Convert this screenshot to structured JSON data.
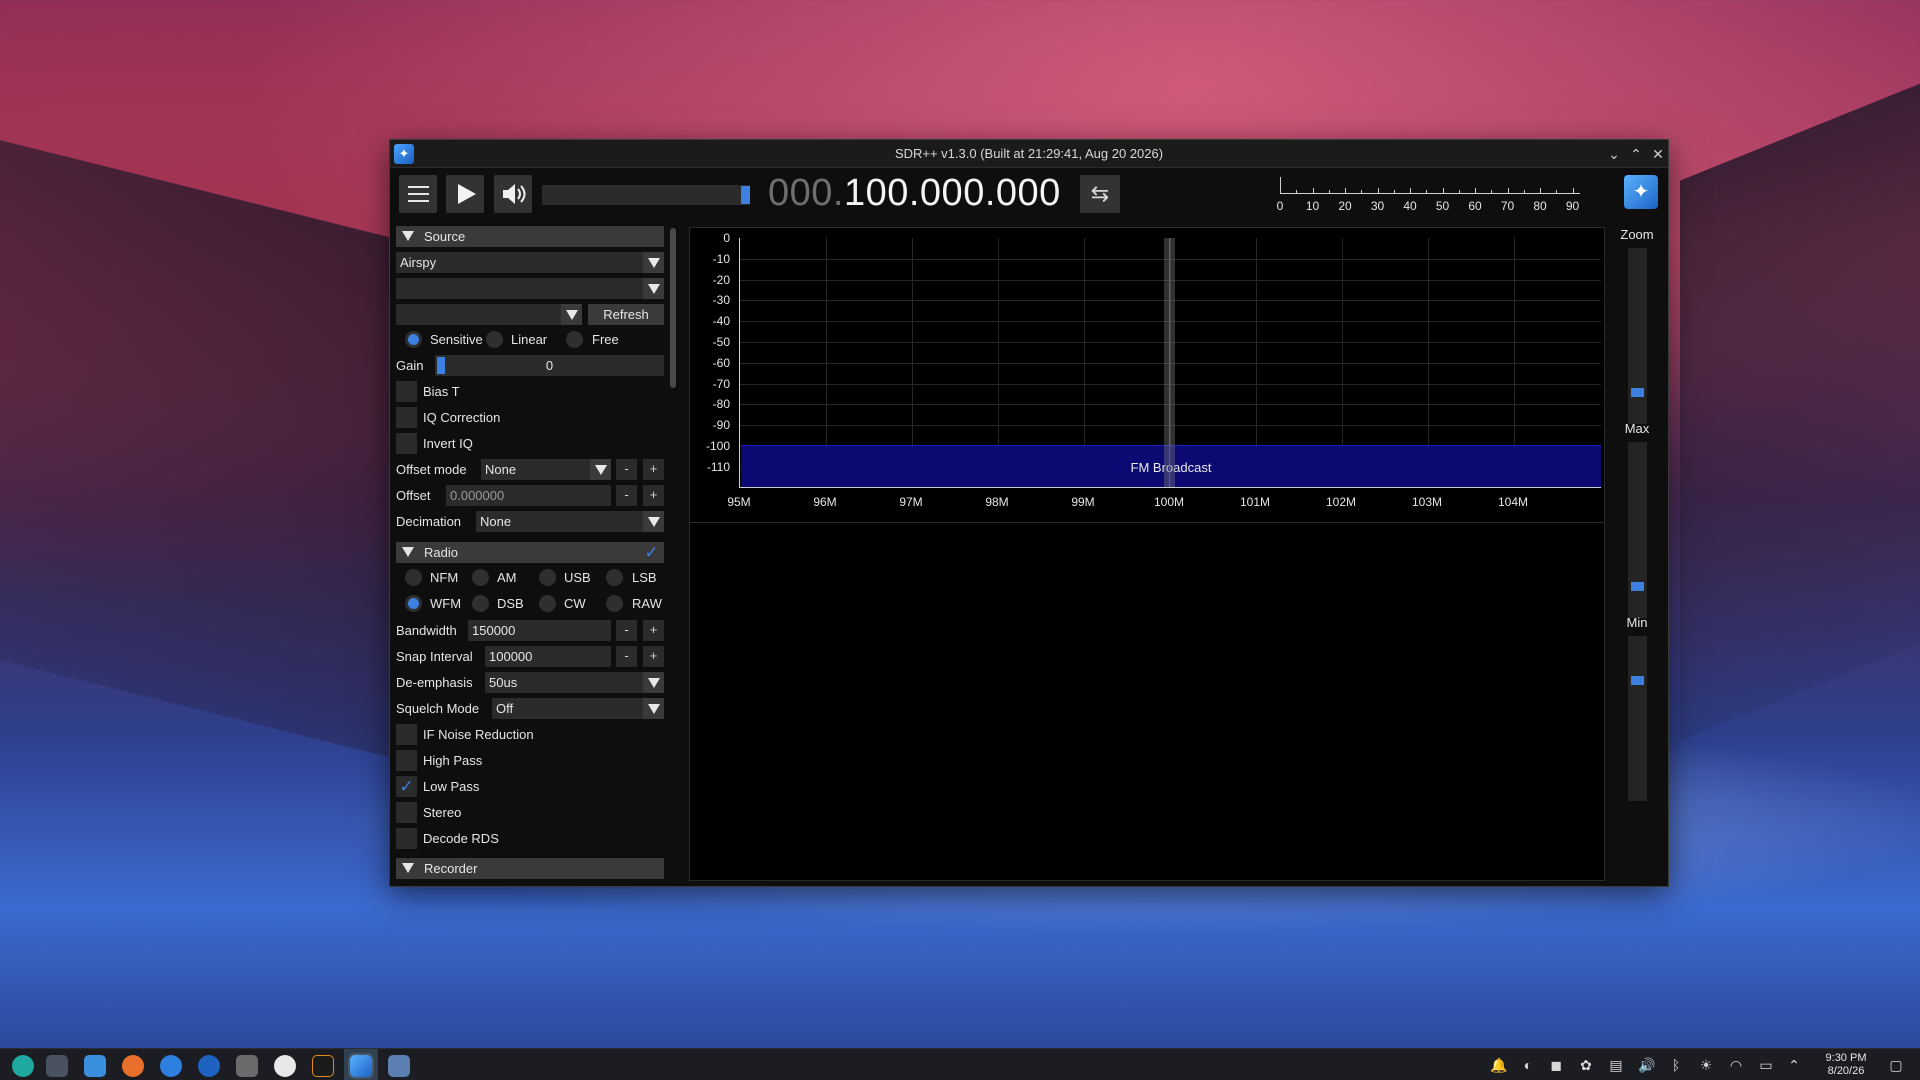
{
  "window": {
    "title": "SDR++ v1.3.0 (Built at 21:29:41, Aug 20 2026)",
    "controls": [
      "minimize",
      "maximize",
      "close"
    ]
  },
  "toolbar": {
    "frequency_dim": "000.",
    "frequency_main": "100.000.000",
    "volume_level": 1.0,
    "snr_scale": [
      "0",
      "10",
      "20",
      "30",
      "40",
      "50",
      "60",
      "70",
      "80",
      "90"
    ],
    "swap_glyph": "⇆"
  },
  "source": {
    "header": "Source",
    "device": "Airspy",
    "device2": "",
    "samplerate": "",
    "refresh_label": "Refresh",
    "gain_modes": [
      "Sensitive",
      "Linear",
      "Free"
    ],
    "gain_mode_selected": "Sensitive",
    "gain_label": "Gain",
    "gain_value": "0",
    "bias_t": "Bias T",
    "iq_correction": "IQ Correction",
    "invert_iq": "Invert IQ",
    "offset_mode_label": "Offset mode",
    "offset_mode_value": "None",
    "offset_label": "Offset",
    "offset_value": "0.000000",
    "decimation_label": "Decimation",
    "decimation_value": "None",
    "minus": "-",
    "plus": "+"
  },
  "radio": {
    "header": "Radio",
    "enabled": true,
    "modes_row1": [
      "NFM",
      "AM",
      "USB",
      "LSB"
    ],
    "modes_row2": [
      "WFM",
      "DSB",
      "CW",
      "RAW"
    ],
    "mode_selected": "WFM",
    "bandwidth_label": "Bandwidth",
    "bandwidth_value": "150000",
    "snap_label": "Snap Interval",
    "snap_value": "100000",
    "deemph_label": "De-emphasis",
    "deemph_value": "50us",
    "squelch_label": "Squelch Mode",
    "squelch_value": "Off",
    "if_nr": "IF Noise Reduction",
    "high_pass": "High Pass",
    "low_pass": "Low Pass",
    "low_pass_checked": true,
    "stereo": "Stereo",
    "decode_rds": "Decode RDS"
  },
  "recorder": {
    "header": "Recorder"
  },
  "spectrum": {
    "y_labels": [
      "0",
      "-10",
      "-20",
      "-30",
      "-40",
      "-50",
      "-60",
      "-70",
      "-80",
      "-90",
      "-100",
      "-110"
    ],
    "x_labels": [
      "95M",
      "96M",
      "97M",
      "98M",
      "99M",
      "100M",
      "101M",
      "102M",
      "103M",
      "104M"
    ],
    "band_name": "FM Broadcast",
    "colors": {
      "band": "#0a0a72",
      "vfo_line": "#c23a3a",
      "accent": "#3d80e0"
    }
  },
  "side": {
    "zoom_label": "Zoom",
    "max_label": "Max",
    "min_label": "Min"
  },
  "taskbar": {
    "time": "9:30 PM",
    "date": "8/20/26"
  }
}
